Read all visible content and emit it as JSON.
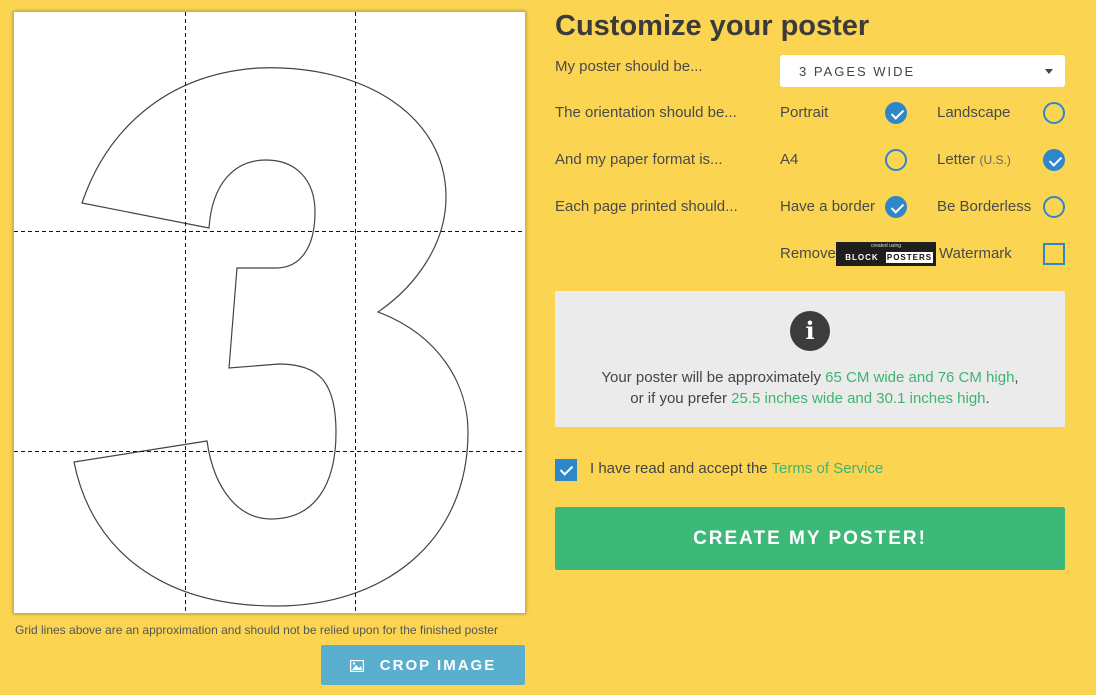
{
  "preview": {
    "grid_note": "Grid lines above are an approximation and should not be relied upon for the finished poster",
    "crop_button_label": "CROP IMAGE"
  },
  "panel": {
    "title": "Customize your poster",
    "size_label": "My poster should be...",
    "size_value": "3 PAGES WIDE",
    "orientation_label": "The orientation should be...",
    "orientation_options": [
      "Portrait",
      "Landscape"
    ],
    "orientation_selected": "Portrait",
    "paper_label": "And my paper format is...",
    "paper_options": [
      "A4",
      "Letter"
    ],
    "paper_letter_note": "(U.S.)",
    "paper_selected": "Letter",
    "border_label": "Each page printed should...",
    "border_options": [
      "Have a border",
      "Be Borderless"
    ],
    "border_selected": "Have a border",
    "watermark_prefix": "Remove",
    "watermark_suffix": "Watermark",
    "watermark_checked": false,
    "logo_small": "created using",
    "logo_word1": "BLOCK",
    "logo_word2": "POSTERS"
  },
  "info": {
    "icon": "info-icon",
    "line1_prefix": "Your poster will be approximately ",
    "line1_value": "65 CM wide and 76 CM high",
    "line1_suffix": ",",
    "line2_prefix": "or if you prefer ",
    "line2_value": "25.5 inches wide and 30.1 inches high",
    "line2_suffix": "."
  },
  "terms": {
    "checked": true,
    "label": "I have read and accept the ",
    "link": "Terms of Service"
  },
  "create_button_label": "CREATE MY POSTER!",
  "colors": {
    "background": "#fbd551",
    "accent_blue": "#2f86c9",
    "accent_green": "#3cb878",
    "crop_button": "#5aafcf"
  }
}
